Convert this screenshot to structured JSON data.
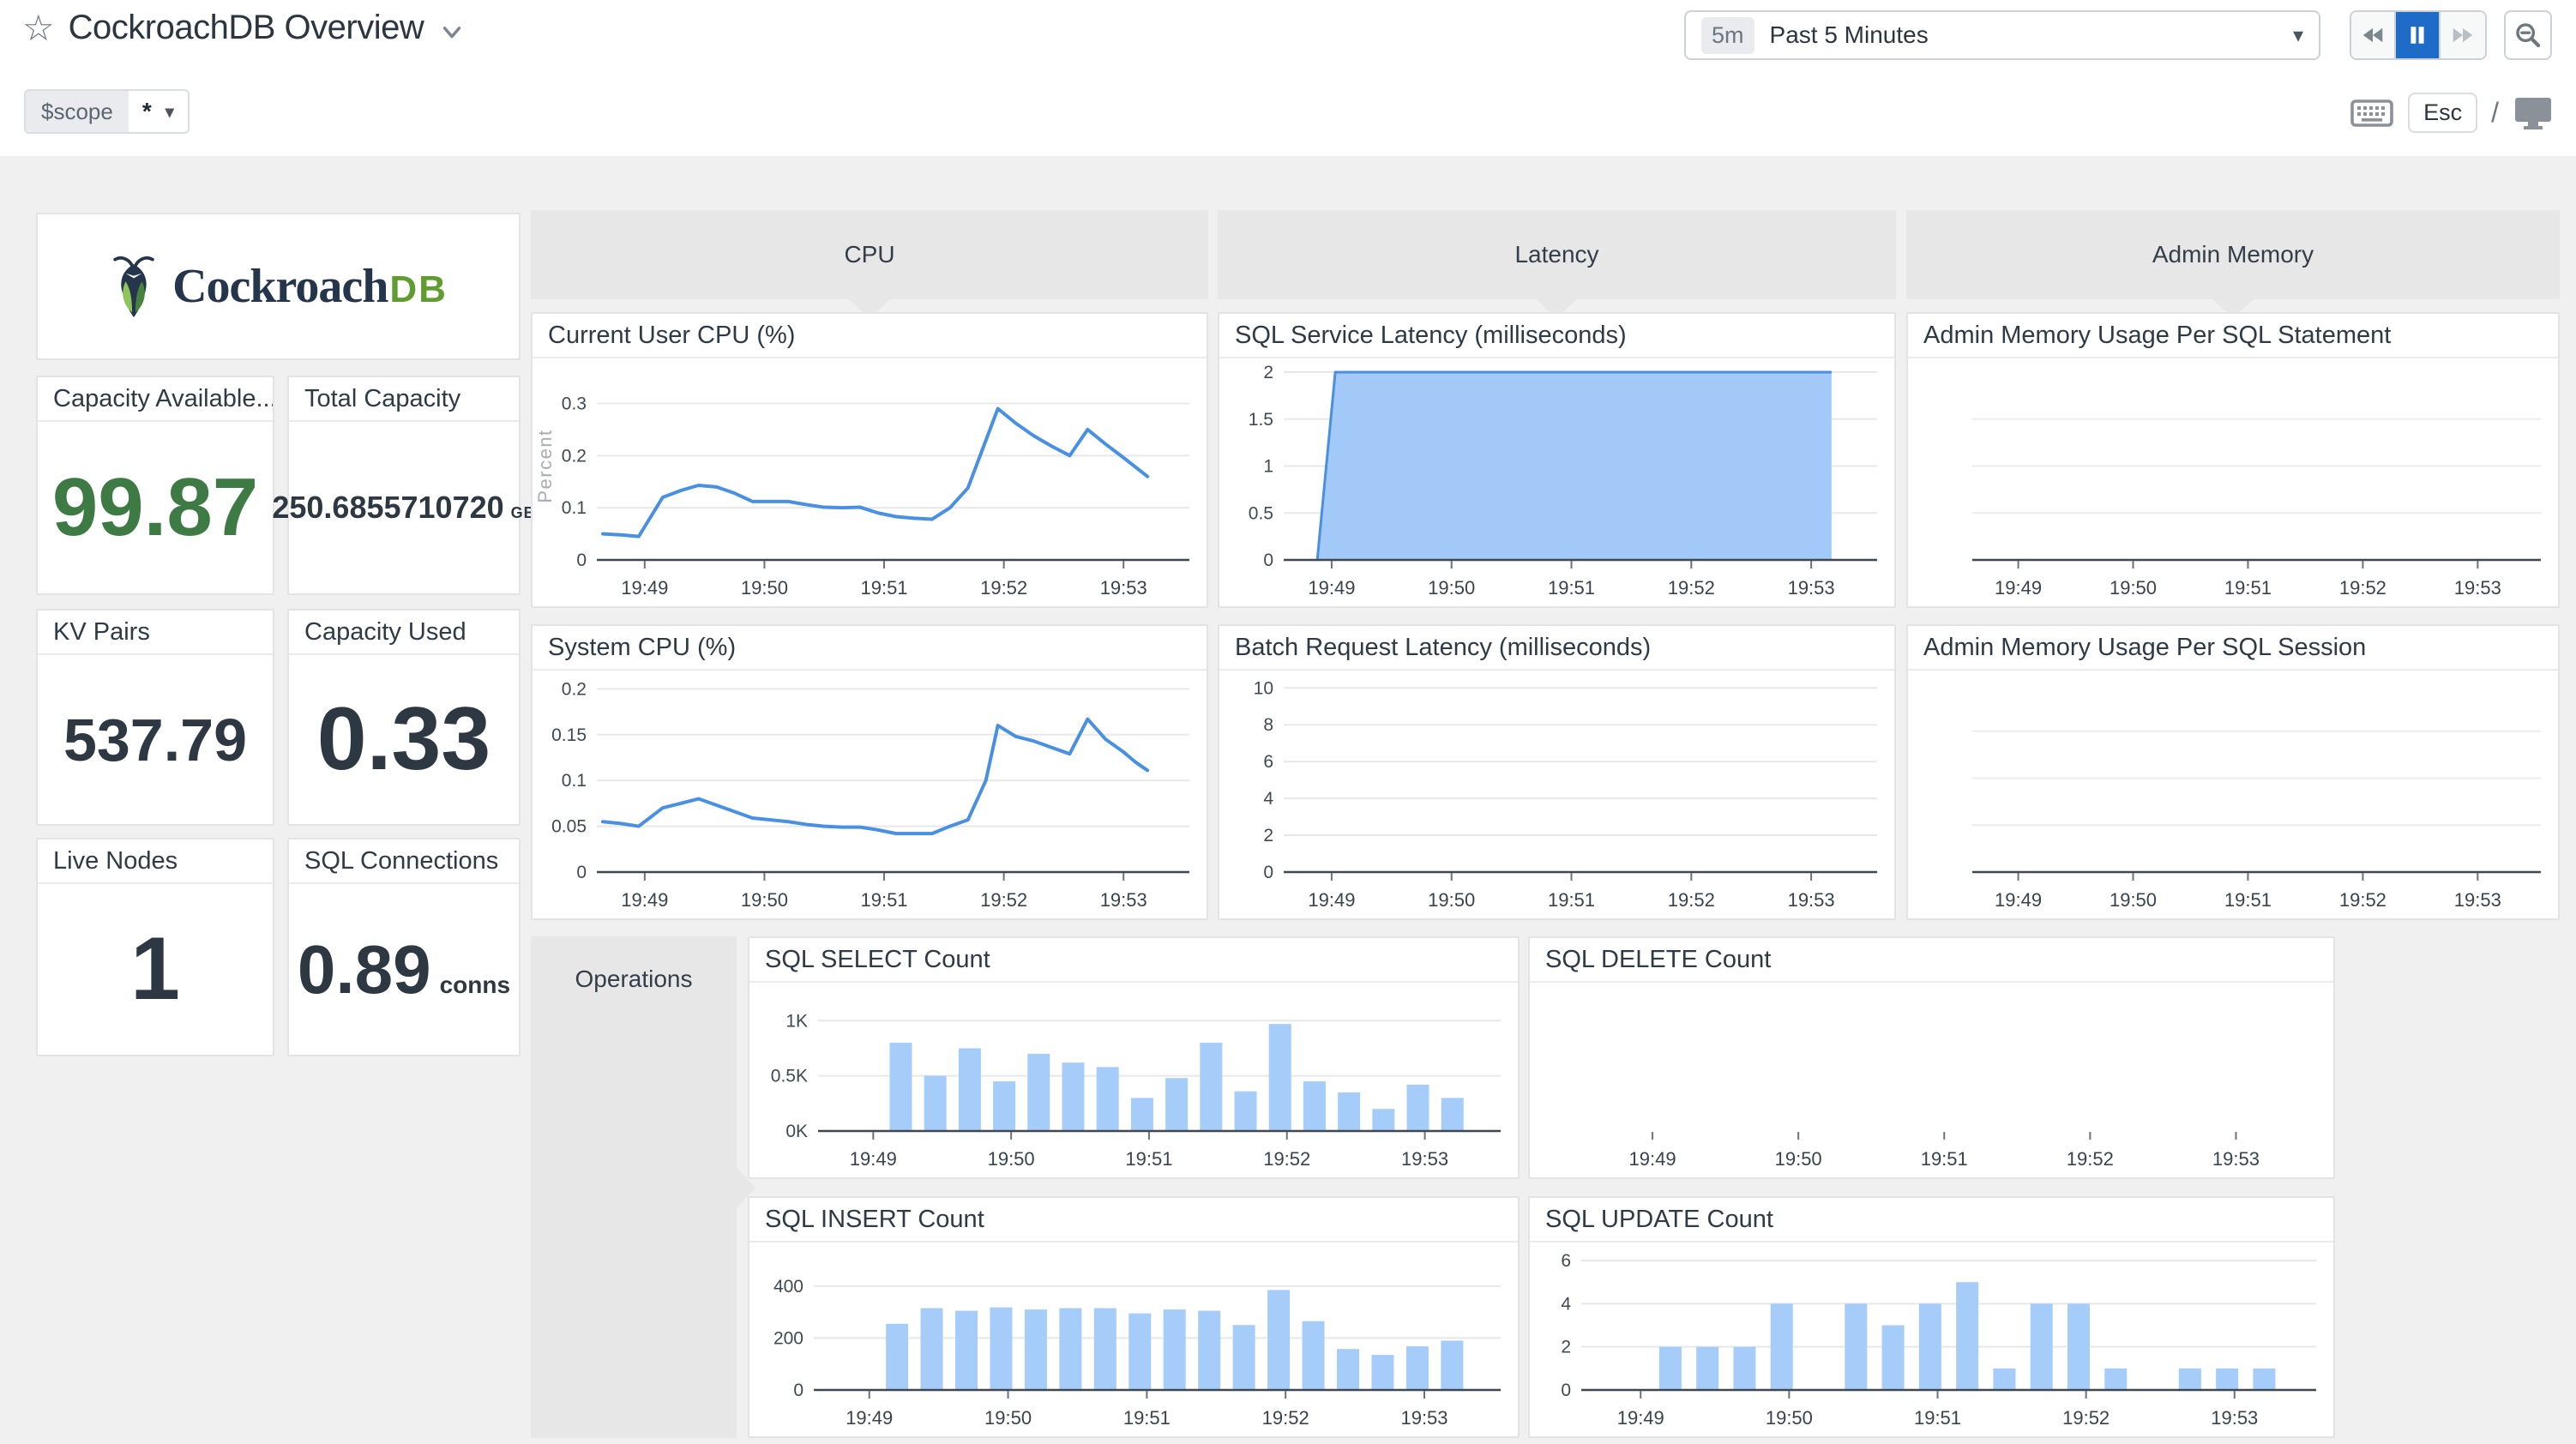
{
  "topbar": {
    "title": "CockroachDB Overview",
    "time_range_badge": "5m",
    "time_range_label": "Past 5 Minutes",
    "esc_key": "Esc",
    "slash": "/"
  },
  "scope_bar": {
    "label": "$scope",
    "value": "*"
  },
  "logo": {
    "word": "Cockroach",
    "suffix": "DB"
  },
  "stats": [
    {
      "title": "Capacity Available...",
      "value": "99.87"
    },
    {
      "title": "Total Capacity",
      "value": "250.6855710720",
      "unit": "GB"
    },
    {
      "title": "KV Pairs",
      "value": "537.79"
    },
    {
      "title": "Capacity Used",
      "value": "0.33"
    },
    {
      "title": "Live Nodes",
      "value": "1"
    },
    {
      "title": "SQL Connections",
      "value": "0.89",
      "unit": "conns"
    }
  ],
  "groups": {
    "cpu": "CPU",
    "latency": "Latency",
    "admin_memory": "Admin Memory",
    "operations": "Operations"
  },
  "colors": {
    "accent_blue": "#1e6cc8",
    "line_blue": "#4a90e2",
    "area_fill": "#a3c9f8",
    "bar_fill": "#a6cdfa",
    "stat_green": "#3d7a44",
    "stat_dark": "#2d3843",
    "header_gray": "#e7e7e8"
  },
  "chart_data": [
    {
      "id": "current-user-cpu",
      "group": "CPU",
      "title": "Current User CPU (%)",
      "type": "line",
      "ylabel": "Percent",
      "y_max": 0.36,
      "pad_left": 75,
      "y_ticks": [
        {
          "v": 0,
          "label": "0"
        },
        {
          "v": 0.1,
          "label": "0.1"
        },
        {
          "v": 0.2,
          "label": "0.2"
        },
        {
          "v": 0.3,
          "label": "0.3"
        }
      ],
      "x_range": [
        48.6,
        53.55
      ],
      "x_ticks": [
        {
          "t": 49,
          "label": "19:49"
        },
        {
          "t": 50,
          "label": "19:50"
        },
        {
          "t": 51,
          "label": "19:51"
        },
        {
          "t": 52,
          "label": "19:52"
        },
        {
          "t": 53,
          "label": "19:53"
        }
      ],
      "x": [
        48.65,
        48.8,
        48.95,
        49.15,
        49.3,
        49.45,
        49.6,
        49.75,
        49.9,
        50.05,
        50.2,
        50.35,
        50.5,
        50.65,
        50.8,
        50.95,
        51.1,
        51.25,
        51.4,
        51.55,
        51.7,
        51.95,
        52.1,
        52.25,
        52.4,
        52.55,
        52.7,
        52.85,
        53.0,
        53.2
      ],
      "y": [
        0.05,
        0.048,
        0.045,
        0.12,
        0.133,
        0.143,
        0.14,
        0.128,
        0.112,
        0.112,
        0.112,
        0.106,
        0.101,
        0.1,
        0.101,
        0.09,
        0.083,
        0.08,
        0.078,
        0.1,
        0.138,
        0.29,
        0.262,
        0.238,
        0.218,
        0.2,
        0.25,
        0.222,
        0.196,
        0.16
      ]
    },
    {
      "id": "system-cpu",
      "group": "CPU",
      "title": "System CPU (%)",
      "type": "line",
      "y_max": 0.205,
      "pad_left": 75,
      "y_ticks": [
        {
          "v": 0,
          "label": "0"
        },
        {
          "v": 0.05,
          "label": "0.05"
        },
        {
          "v": 0.1,
          "label": "0.1"
        },
        {
          "v": 0.15,
          "label": "0.15"
        },
        {
          "v": 0.2,
          "label": "0.2"
        }
      ],
      "x_range": [
        48.6,
        53.55
      ],
      "x_ticks": [
        {
          "t": 49,
          "label": "19:49"
        },
        {
          "t": 50,
          "label": "19:50"
        },
        {
          "t": 51,
          "label": "19:51"
        },
        {
          "t": 52,
          "label": "19:52"
        },
        {
          "t": 53,
          "label": "19:53"
        }
      ],
      "x": [
        48.65,
        48.8,
        48.95,
        49.15,
        49.3,
        49.45,
        49.6,
        49.75,
        49.9,
        50.05,
        50.2,
        50.35,
        50.5,
        50.65,
        50.8,
        50.95,
        51.1,
        51.25,
        51.4,
        51.55,
        51.7,
        51.85,
        51.95,
        52.1,
        52.25,
        52.4,
        52.55,
        52.7,
        52.85,
        53.0,
        53.1,
        53.2
      ],
      "y": [
        0.055,
        0.053,
        0.05,
        0.07,
        0.075,
        0.08,
        0.073,
        0.066,
        0.059,
        0.057,
        0.055,
        0.052,
        0.05,
        0.049,
        0.049,
        0.046,
        0.042,
        0.042,
        0.042,
        0.05,
        0.057,
        0.1,
        0.16,
        0.148,
        0.143,
        0.136,
        0.129,
        0.167,
        0.145,
        0.131,
        0.12,
        0.111
      ]
    },
    {
      "id": "sql-service-latency",
      "group": "Latency",
      "title": "SQL Service Latency (milliseconds)",
      "type": "area",
      "y_max": 2.0,
      "pad_left": 75,
      "y_ticks": [
        {
          "v": 0,
          "label": "0"
        },
        {
          "v": 0.5,
          "label": "0.5"
        },
        {
          "v": 1,
          "label": "1"
        },
        {
          "v": 1.5,
          "label": "1.5"
        },
        {
          "v": 2,
          "label": "2"
        }
      ],
      "x_range": [
        48.6,
        53.55
      ],
      "x_ticks": [
        {
          "t": 49,
          "label": "19:49"
        },
        {
          "t": 50,
          "label": "19:50"
        },
        {
          "t": 51,
          "label": "19:51"
        },
        {
          "t": 52,
          "label": "19:52"
        },
        {
          "t": 53,
          "label": "19:53"
        }
      ],
      "x": [
        48.88,
        49.03,
        53.17
      ],
      "y": [
        0,
        2,
        2
      ]
    },
    {
      "id": "batch-request-latency",
      "group": "Latency",
      "title": "Batch Request Latency (milliseconds)",
      "type": "empty",
      "y_max": 10.2,
      "pad_left": 75,
      "y_ticks": [
        {
          "v": 0,
          "label": "0"
        },
        {
          "v": 2,
          "label": "2"
        },
        {
          "v": 4,
          "label": "4"
        },
        {
          "v": 6,
          "label": "6"
        },
        {
          "v": 8,
          "label": "8"
        },
        {
          "v": 10,
          "label": "10"
        }
      ],
      "x_range": [
        48.6,
        53.55
      ],
      "x_ticks": [
        {
          "t": 49,
          "label": "19:49"
        },
        {
          "t": 50,
          "label": "19:50"
        },
        {
          "t": 51,
          "label": "19:51"
        },
        {
          "t": 52,
          "label": "19:52"
        },
        {
          "t": 53,
          "label": "19:53"
        }
      ]
    },
    {
      "id": "admin-memory-statement",
      "group": "Admin Memory",
      "title": "Admin Memory Usage Per SQL Statement",
      "type": "empty",
      "y_max": 1,
      "pad_left": 75,
      "grid_fracs": [
        0.25,
        0.5,
        0.75
      ],
      "x_range": [
        48.6,
        53.55
      ],
      "x_ticks": [
        {
          "t": 49,
          "label": "19:49"
        },
        {
          "t": 50,
          "label": "19:50"
        },
        {
          "t": 51,
          "label": "19:51"
        },
        {
          "t": 52,
          "label": "19:52"
        },
        {
          "t": 53,
          "label": "19:53"
        }
      ]
    },
    {
      "id": "admin-memory-session",
      "group": "Admin Memory",
      "title": "Admin Memory Usage Per SQL Session",
      "type": "empty",
      "y_max": 1,
      "pad_left": 75,
      "grid_fracs": [
        0.25,
        0.5,
        0.75
      ],
      "x_range": [
        48.6,
        53.55
      ],
      "x_ticks": [
        {
          "t": 49,
          "label": "19:49"
        },
        {
          "t": 50,
          "label": "19:50"
        },
        {
          "t": 51,
          "label": "19:51"
        },
        {
          "t": 52,
          "label": "19:52"
        },
        {
          "t": 53,
          "label": "19:53"
        }
      ]
    },
    {
      "id": "sql-select-count",
      "group": "Operations",
      "title": "SQL SELECT Count",
      "type": "bars",
      "y_max": 1220,
      "pad_left": 80,
      "y_ticks": [
        {
          "v": 0,
          "label": "0K"
        },
        {
          "v": 500,
          "label": "0.5K"
        },
        {
          "v": 1000,
          "label": "1K"
        }
      ],
      "x_range": [
        48.6,
        53.55
      ],
      "x_ticks": [
        {
          "t": 49,
          "label": "19:49"
        },
        {
          "t": 50,
          "label": "19:50"
        },
        {
          "t": 51,
          "label": "19:51"
        },
        {
          "t": 52,
          "label": "19:52"
        },
        {
          "t": 53,
          "label": "19:53"
        }
      ],
      "x": [
        49.2,
        49.45,
        49.7,
        49.95,
        50.2,
        50.45,
        50.7,
        50.95,
        51.2,
        51.45,
        51.7,
        51.95,
        52.2,
        52.45,
        52.7,
        52.95,
        53.2
      ],
      "values": [
        800,
        500,
        750,
        450,
        700,
        620,
        580,
        300,
        480,
        800,
        360,
        970,
        450,
        350,
        200,
        420,
        300
      ]
    },
    {
      "id": "sql-delete-count",
      "group": "Operations",
      "title": "SQL DELETE Count",
      "type": "empty",
      "y_max": 1,
      "pad_left": 75,
      "x_line": false,
      "x_range": [
        48.6,
        53.55
      ],
      "x_ticks": [
        {
          "t": 49,
          "label": "19:49"
        },
        {
          "t": 50,
          "label": "19:50"
        },
        {
          "t": 51,
          "label": "19:51"
        },
        {
          "t": 52,
          "label": "19:52"
        },
        {
          "t": 53,
          "label": "19:53"
        }
      ]
    },
    {
      "id": "sql-insert-count",
      "group": "Operations",
      "title": "SQL INSERT Count",
      "type": "bars",
      "y_max": 515,
      "pad_left": 75,
      "y_ticks": [
        {
          "v": 0,
          "label": "0"
        },
        {
          "v": 200,
          "label": "200"
        },
        {
          "v": 400,
          "label": "400"
        }
      ],
      "x_range": [
        48.6,
        53.55
      ],
      "x_ticks": [
        {
          "t": 49,
          "label": "19:49"
        },
        {
          "t": 50,
          "label": "19:50"
        },
        {
          "t": 51,
          "label": "19:51"
        },
        {
          "t": 52,
          "label": "19:52"
        },
        {
          "t": 53,
          "label": "19:53"
        }
      ],
      "x": [
        49.2,
        49.45,
        49.7,
        49.95,
        50.2,
        50.45,
        50.7,
        50.95,
        51.2,
        51.45,
        51.7,
        51.95,
        52.2,
        52.45,
        52.7,
        52.95,
        53.2
      ],
      "values": [
        255,
        315,
        305,
        318,
        310,
        315,
        315,
        295,
        310,
        305,
        250,
        385,
        265,
        158,
        135,
        168,
        190
      ]
    },
    {
      "id": "sql-update-count",
      "group": "Operations",
      "title": "SQL UPDATE Count",
      "type": "bars",
      "y_max": 6.2,
      "pad_left": 60,
      "y_ticks": [
        {
          "v": 0,
          "label": "0"
        },
        {
          "v": 2,
          "label": "2"
        },
        {
          "v": 4,
          "label": "4"
        },
        {
          "v": 6,
          "label": "6"
        }
      ],
      "x_range": [
        48.6,
        53.55
      ],
      "x_ticks": [
        {
          "t": 49,
          "label": "19:49"
        },
        {
          "t": 50,
          "label": "19:50"
        },
        {
          "t": 51,
          "label": "19:51"
        },
        {
          "t": 52,
          "label": "19:52"
        },
        {
          "t": 53,
          "label": "19:53"
        }
      ],
      "x": [
        49.2,
        49.45,
        49.7,
        49.95,
        50.2,
        50.45,
        50.7,
        50.95,
        51.2,
        51.45,
        51.7,
        51.95,
        52.2,
        52.45,
        52.7,
        52.95,
        53.2
      ],
      "values": [
        2,
        2,
        2,
        4,
        0,
        4,
        3,
        4,
        5,
        1,
        4,
        4,
        1,
        0,
        1,
        1,
        1
      ]
    }
  ]
}
